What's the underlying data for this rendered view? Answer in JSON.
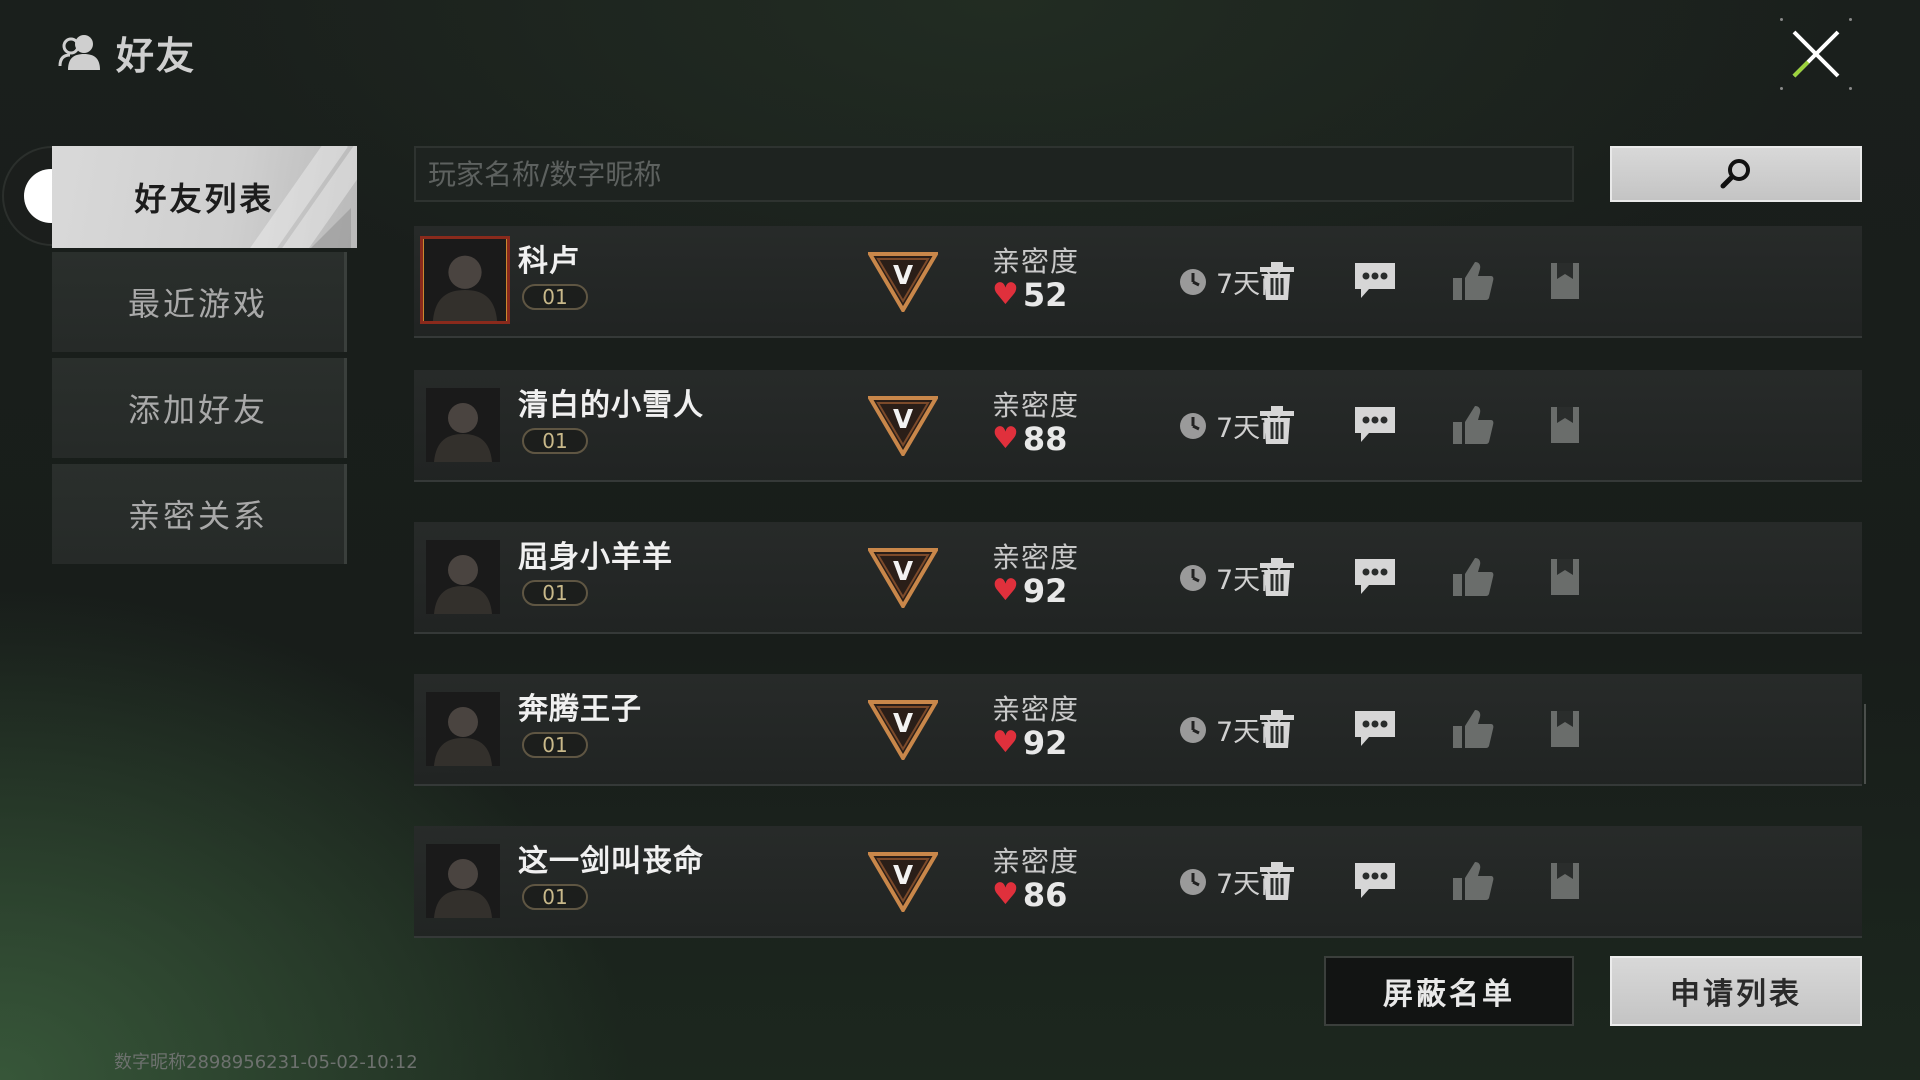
{
  "header": {
    "title": "好友",
    "icon": "friends-icon"
  },
  "close": {
    "icon": "close-icon"
  },
  "sidebar": {
    "items": [
      {
        "label": "好友列表",
        "active": true
      },
      {
        "label": "最近游戏",
        "active": false
      },
      {
        "label": "添加好友",
        "active": false
      },
      {
        "label": "亲密关系",
        "active": false
      }
    ]
  },
  "search": {
    "placeholder": "玩家名称/数字昵称",
    "value": "",
    "button_icon": "search-icon"
  },
  "friends_header": {
    "intimacy_label": "亲密度"
  },
  "friends": [
    {
      "name": "科卢",
      "level": "01",
      "rank": "V",
      "intimacy_label": "亲密度",
      "intimacy": "52",
      "last_seen": "7天前"
    },
    {
      "name": "清白的小雪人",
      "level": "01",
      "rank": "V",
      "intimacy_label": "亲密度",
      "intimacy": "88",
      "last_seen": "7天前"
    },
    {
      "name": "屈身小羊羊",
      "level": "01",
      "rank": "V",
      "intimacy_label": "亲密度",
      "intimacy": "92",
      "last_seen": "7天前"
    },
    {
      "name": "奔腾王子",
      "level": "01",
      "rank": "V",
      "intimacy_label": "亲密度",
      "intimacy": "92",
      "last_seen": "7天前"
    },
    {
      "name": "这一剑叫丧命",
      "level": "01",
      "rank": "V",
      "intimacy_label": "亲密度",
      "intimacy": "86",
      "last_seen": "7天前"
    }
  ],
  "actions": [
    "delete-icon",
    "chat-icon",
    "like-icon",
    "bookmark-icon"
  ],
  "bottom": {
    "block_list_label": "屏蔽名单",
    "apply_list_label": "申请列表"
  },
  "footer": {
    "id_text": "数字昵称2898956231-05-02-10:12"
  },
  "colors": {
    "heart": "#e0303c",
    "accent_light": "#d0d0d0",
    "rank_border": "#c9874a"
  }
}
